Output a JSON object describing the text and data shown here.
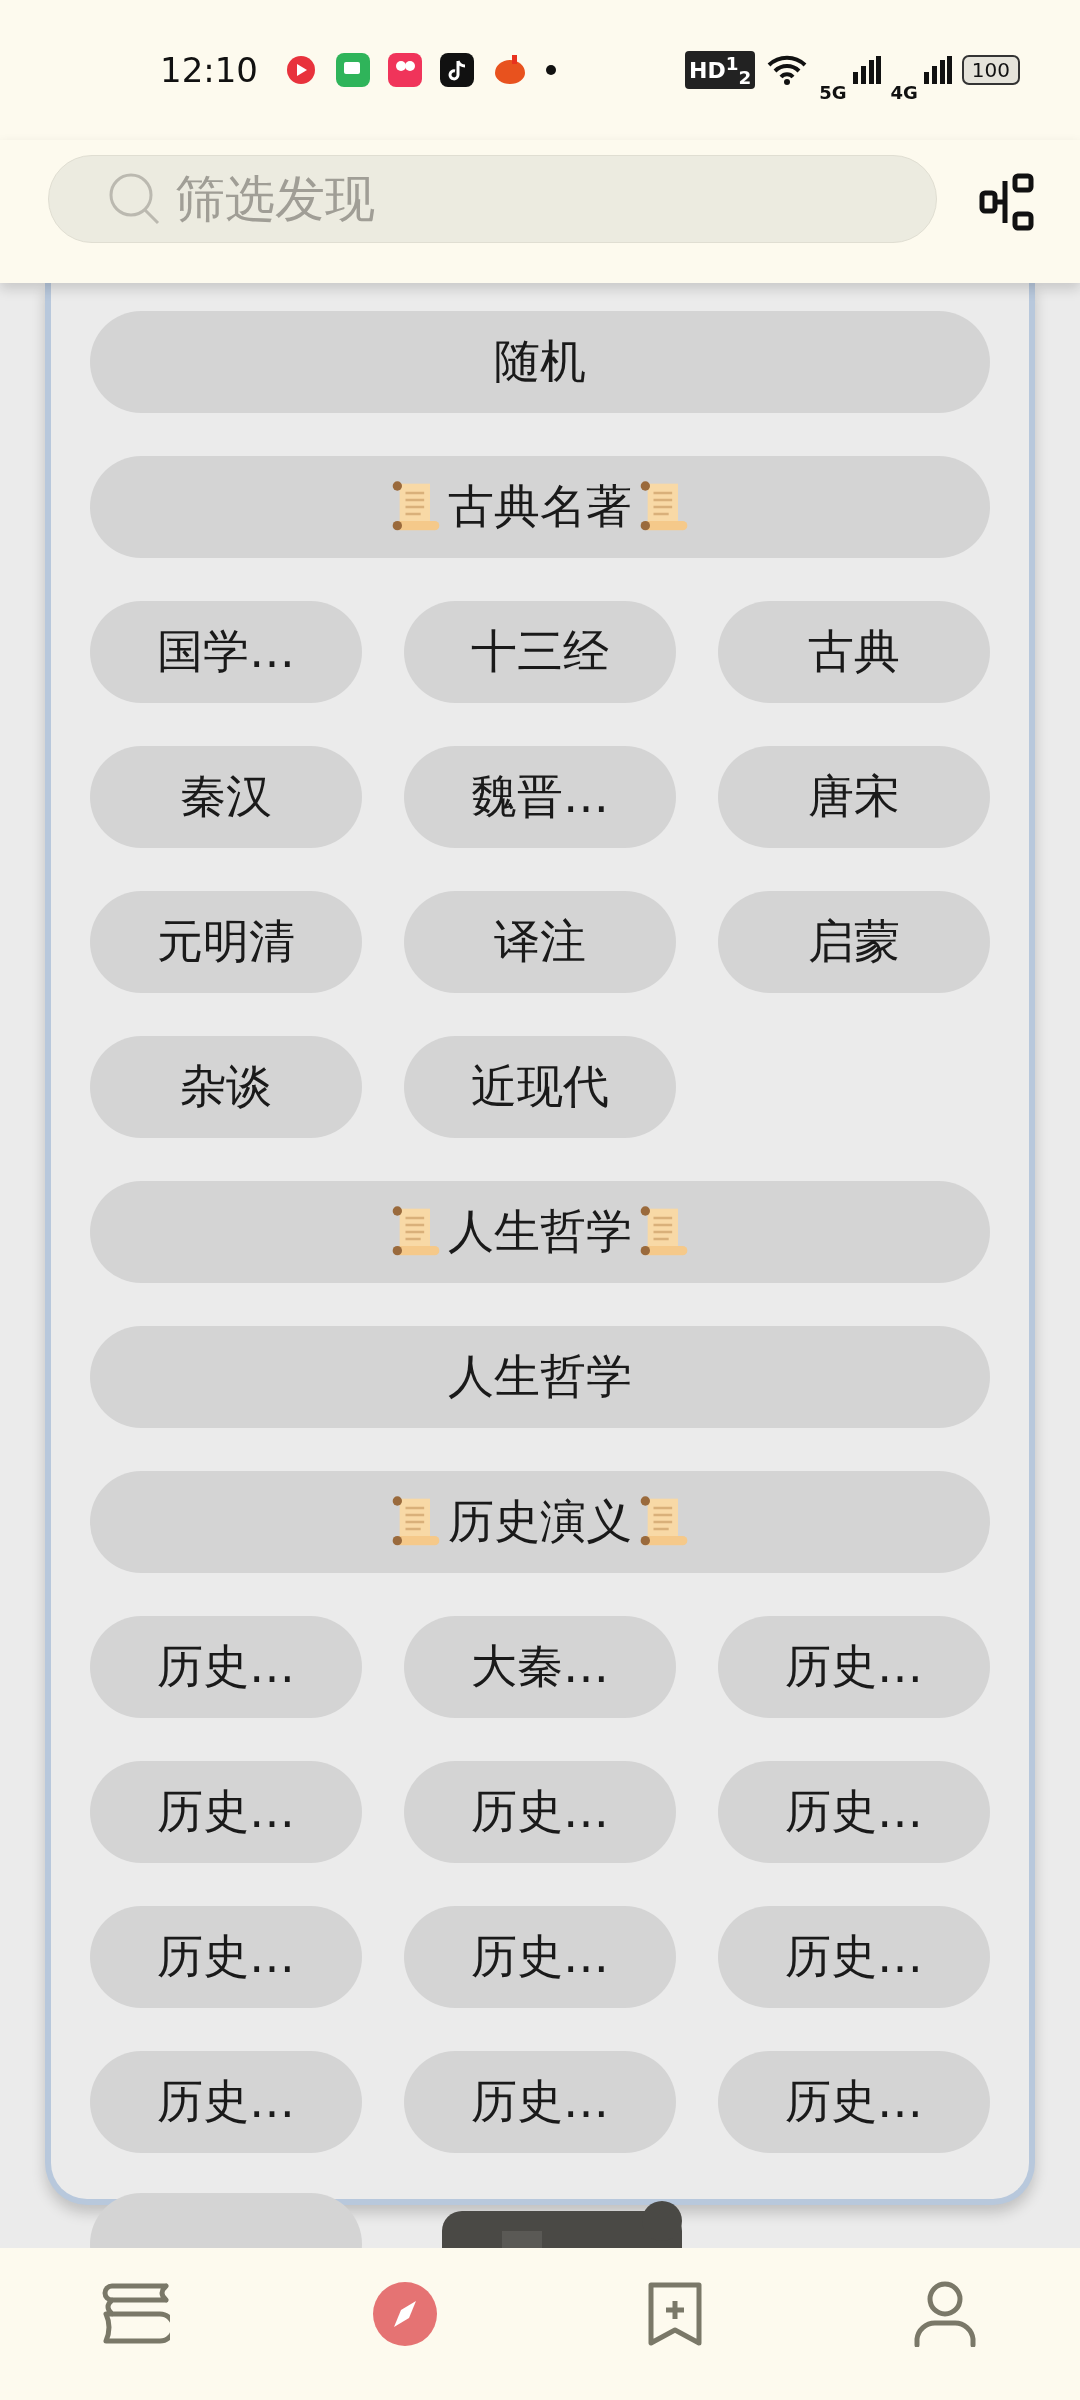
{
  "status_bar": {
    "time": "12:10",
    "hd": "HD$^{1}$$_{2}$",
    "network_1": "5G",
    "network_2": "4G",
    "battery": "100"
  },
  "search": {
    "placeholder": "筛选发现"
  },
  "sections": [
    {
      "kind": "wide",
      "label": "随机"
    },
    {
      "kind": "header",
      "label": "古典名著"
    },
    {
      "kind": "grid",
      "chips": [
        "国学…",
        "十三经",
        "古典",
        "秦汉",
        "魏晋…",
        "唐宋",
        "元明清",
        "译注",
        "启蒙",
        "杂谈",
        "近现代"
      ]
    },
    {
      "kind": "header",
      "label": "人生哲学"
    },
    {
      "kind": "wide",
      "label": "人生哲学"
    },
    {
      "kind": "header",
      "label": "历史演义"
    },
    {
      "kind": "grid",
      "chips": [
        "历史…",
        "大秦…",
        "历史…",
        "历史…",
        "历史…",
        "历史…",
        "历史…",
        "历史…",
        "历史…",
        "历史…",
        "历史…",
        "历史…"
      ]
    }
  ],
  "bottom_nav": [
    {
      "kind": "bookshelf",
      "selected": false
    },
    {
      "kind": "discover",
      "selected": true
    },
    {
      "kind": "bookmark",
      "selected": false
    },
    {
      "kind": "profile",
      "selected": false
    }
  ]
}
